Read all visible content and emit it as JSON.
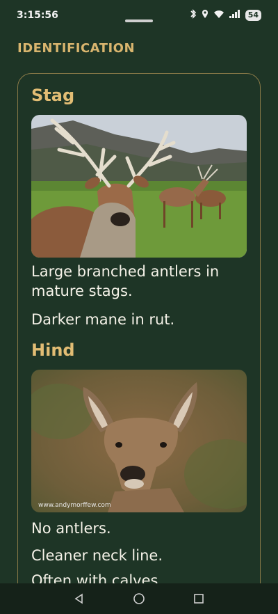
{
  "status_bar": {
    "time": "3:15:56",
    "battery": "54"
  },
  "page": {
    "section_title": "IDENTIFICATION"
  },
  "species": [
    {
      "title": "Stag",
      "photo": "red deer stag with large antlers in front of mountains and other deer on grass",
      "lines": [
        "Large branched antlers in mature stags.",
        "Darker mane in rut."
      ]
    },
    {
      "title": "Hind",
      "photo": "red deer hind portrait with large ears, blurred autumn background",
      "watermark": "www.andymorffew.com",
      "lines": [
        "No antlers.",
        "Cleaner neck line.",
        "Often with calves."
      ]
    }
  ],
  "colors": {
    "background": "#1e3526",
    "accent": "#d9b56e",
    "card_border": "#8a7a48"
  }
}
